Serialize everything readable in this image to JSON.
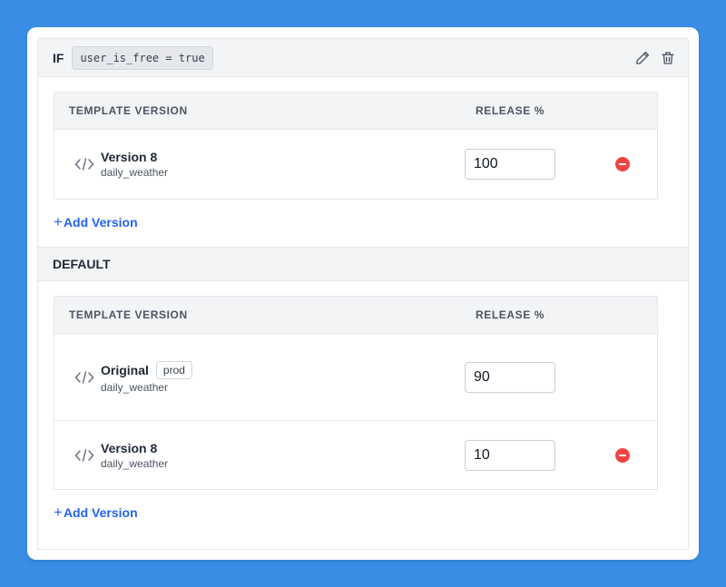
{
  "rule": {
    "if_label": "IF",
    "condition": "user_is_free = true",
    "actions": {
      "edit_icon": "pencil-icon",
      "delete_icon": "trash-icon"
    }
  },
  "columns": {
    "template": "TEMPLATE VERSION",
    "release": "RELEASE %"
  },
  "if_section": {
    "rows": [
      {
        "name": "Version 8",
        "template": "daily_weather",
        "release": "100",
        "badge": "",
        "removable": true
      }
    ],
    "add_label": "Add Version"
  },
  "default_section": {
    "label": "DEFAULT",
    "rows": [
      {
        "name": "Original",
        "template": "daily_weather",
        "release": "90",
        "badge": "prod",
        "removable": false
      },
      {
        "name": "Version 8",
        "template": "daily_weather",
        "release": "10",
        "badge": "",
        "removable": true
      }
    ],
    "add_label": "Add Version"
  },
  "colors": {
    "background": "#3a8ee6",
    "link": "#2563eb",
    "remove": "#ef4444",
    "header_bg": "#f3f4f6"
  }
}
